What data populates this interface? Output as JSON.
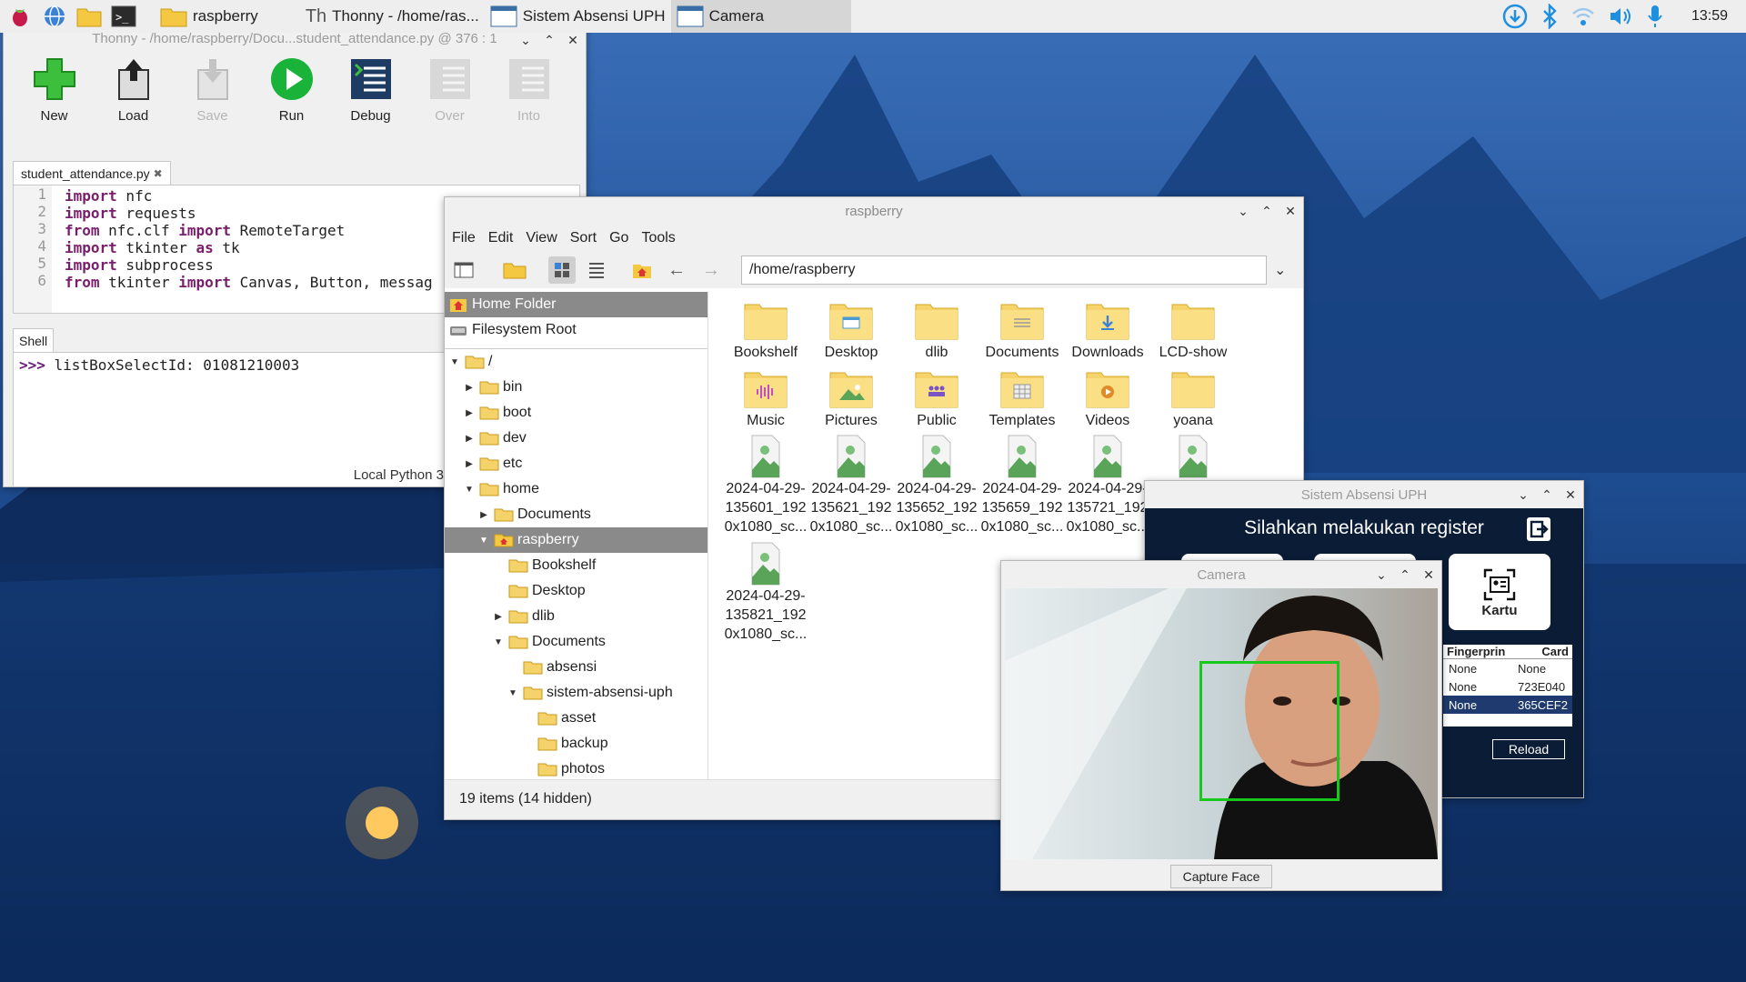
{
  "taskbar": {
    "tasks": [
      {
        "label": "raspberry",
        "icon": "folder-icon"
      },
      {
        "label": "Thonny  -  /home/ras...",
        "icon": "thonny-icon"
      },
      {
        "label": "Sistem Absensi UPH",
        "icon": "window-icon"
      },
      {
        "label": "Camera",
        "icon": "window-icon"
      }
    ],
    "clock": "13:59"
  },
  "thonny": {
    "title": "Thonny  -  /home/raspberry/Docu...student_attendance.py  @  376 : 1",
    "tools": [
      {
        "label": "New",
        "enabled": true
      },
      {
        "label": "Load",
        "enabled": true
      },
      {
        "label": "Save",
        "enabled": false
      },
      {
        "label": "Run",
        "enabled": true
      },
      {
        "label": "Debug",
        "enabled": true
      },
      {
        "label": "Over",
        "enabled": false
      },
      {
        "label": "Into",
        "enabled": false
      }
    ],
    "tab": "student_attendance.py",
    "tab_close": "✖",
    "code_lines": [
      {
        "n": "1",
        "kw1": "import",
        "rest1": " nfc",
        "kw2": "",
        "rest2": ""
      },
      {
        "n": "2",
        "kw1": "import",
        "rest1": " requests",
        "kw2": "",
        "rest2": ""
      },
      {
        "n": "3",
        "kw1": "from",
        "rest1": " nfc.clf ",
        "kw2": "import",
        "rest2": " RemoteTarget"
      },
      {
        "n": "4",
        "kw1": "import",
        "rest1": " tkinter ",
        "kw2": "as",
        "rest2": " tk"
      },
      {
        "n": "5",
        "kw1": "import",
        "rest1": " subprocess",
        "kw2": "",
        "rest2": ""
      },
      {
        "n": "6",
        "kw1": "from",
        "rest1": " tkinter ",
        "kw2": "import",
        "rest2": " Canvas, Button, messag"
      }
    ],
    "shell_tab": "Shell",
    "shell_prompt": ">>>",
    "shell_output": " listBoxSelectId: 01081210003",
    "interpreter": "Local Python 3"
  },
  "filemgr": {
    "title": "raspberry",
    "menu": [
      "File",
      "Edit",
      "View",
      "Sort",
      "Go",
      "Tools"
    ],
    "path": "/home/raspberry",
    "places": [
      "Home Folder",
      "Filesystem Root"
    ],
    "tree": [
      {
        "label": "/",
        "depth": 0,
        "tri": "▼",
        "sel": false
      },
      {
        "label": "bin",
        "depth": 1,
        "tri": "▶",
        "sel": false
      },
      {
        "label": "boot",
        "depth": 1,
        "tri": "▶",
        "sel": false
      },
      {
        "label": "dev",
        "depth": 1,
        "tri": "▶",
        "sel": false
      },
      {
        "label": "etc",
        "depth": 1,
        "tri": "▶",
        "sel": false
      },
      {
        "label": "home",
        "depth": 1,
        "tri": "▼",
        "sel": false
      },
      {
        "label": "Documents",
        "depth": 2,
        "tri": "▶",
        "sel": false
      },
      {
        "label": "raspberry",
        "depth": 2,
        "tri": "▼",
        "sel": true
      },
      {
        "label": "Bookshelf",
        "depth": 3,
        "tri": "",
        "sel": false
      },
      {
        "label": "Desktop",
        "depth": 3,
        "tri": "",
        "sel": false
      },
      {
        "label": "dlib",
        "depth": 3,
        "tri": "▶",
        "sel": false
      },
      {
        "label": "Documents",
        "depth": 3,
        "tri": "▼",
        "sel": false
      },
      {
        "label": "absensi",
        "depth": 4,
        "tri": "",
        "sel": false
      },
      {
        "label": "sistem-absensi-uph",
        "depth": 4,
        "tri": "▼",
        "sel": false
      },
      {
        "label": "asset",
        "depth": 5,
        "tri": "",
        "sel": false
      },
      {
        "label": "backup",
        "depth": 5,
        "tri": "",
        "sel": false
      },
      {
        "label": "photos",
        "depth": 5,
        "tri": "",
        "sel": false
      }
    ],
    "items": [
      {
        "label": "Bookshelf",
        "icon": "folder"
      },
      {
        "label": "Desktop",
        "icon": "folder-desktop"
      },
      {
        "label": "dlib",
        "icon": "folder"
      },
      {
        "label": "Documents",
        "icon": "folder-documents"
      },
      {
        "label": "Downloads",
        "icon": "folder-downloads"
      },
      {
        "label": "LCD-show",
        "icon": "folder"
      },
      {
        "label": "Music",
        "icon": "folder-music"
      },
      {
        "label": "Pictures",
        "icon": "folder-pictures"
      },
      {
        "label": "Public",
        "icon": "folder-public"
      },
      {
        "label": "Templates",
        "icon": "folder-templates"
      },
      {
        "label": "Videos",
        "icon": "folder-videos"
      },
      {
        "label": "yoana",
        "icon": "folder"
      },
      {
        "label": "2024-04-29-135601_192 0x1080_sc...",
        "icon": "image"
      },
      {
        "label": "2024-04-29-135621_192 0x1080_sc...",
        "icon": "image"
      },
      {
        "label": "2024-04-29-135652_192 0x1080_sc...",
        "icon": "image"
      },
      {
        "label": "2024-04-29-135659_192 0x1080_sc...",
        "icon": "image"
      },
      {
        "label": "2024-04-29-135721_192 0x1080_sc...",
        "icon": "image"
      },
      {
        "label": "",
        "icon": "image"
      },
      {
        "label": "2024-04-29-135821_192 0x1080_sc...",
        "icon": "image"
      }
    ],
    "status": "19 items (14 hidden)"
  },
  "absensi": {
    "title": "Sistem Absensi UPH",
    "heading": "Silahkan melakukan register",
    "card_label": "Kartu",
    "table_headers": [
      "Fingerprin",
      "Card"
    ],
    "rows": [
      {
        "c1": "None",
        "c2": "None",
        "sel": false
      },
      {
        "c1": "None",
        "c2": "723E040",
        "sel": false
      },
      {
        "c1": "None",
        "c2": "365CEF2",
        "sel": true
      }
    ],
    "reload": "Reload"
  },
  "camera": {
    "title": "Camera",
    "capture": "Capture Face"
  },
  "colors": {
    "taskbar": "#eeeeee",
    "selection": "#8a8a8a",
    "absensi_bg": "#0a1c36",
    "face_box": "#18c81c",
    "run_green": "#19b33a"
  }
}
